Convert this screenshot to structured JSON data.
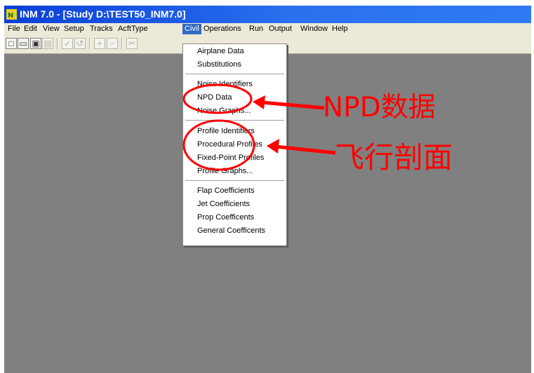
{
  "window": {
    "title": "INM 7.0 - [Study D:\\TEST50_INM7.0]"
  },
  "menubar": [
    "File",
    "Edit",
    "View",
    "Setup",
    "Tracks",
    "AcftType",
    "Civil",
    "Operations",
    "Run",
    "Output",
    "Window",
    "Help"
  ],
  "active_menu": "Civil",
  "dropdown": {
    "items": [
      "Airplane Data",
      "Substitutions",
      "Noise Identifiers",
      "NPD Data",
      "Noise Graphs...",
      "Profile Identifiers",
      "Procedural Profiles",
      "Fixed-Point Profiles",
      "Profile Graphs...",
      "Flap Coefficients",
      "Jet Coefficients",
      "Prop Coefficents",
      "General Coefficents"
    ]
  },
  "annotations": {
    "npd": "NPD数据",
    "profile": "飞行剖面"
  },
  "colors": {
    "annotation": "#ff0000",
    "workspace": "#808080",
    "titlebar": "#0a3fd8",
    "menu_highlight": "#316ac5"
  },
  "toolbar_icons": [
    "new-file-icon",
    "open-folder-icon",
    "save-icon",
    "print-icon",
    "check-icon",
    "undo-icon",
    "plus-icon",
    "minus-icon",
    "cut-icon"
  ]
}
